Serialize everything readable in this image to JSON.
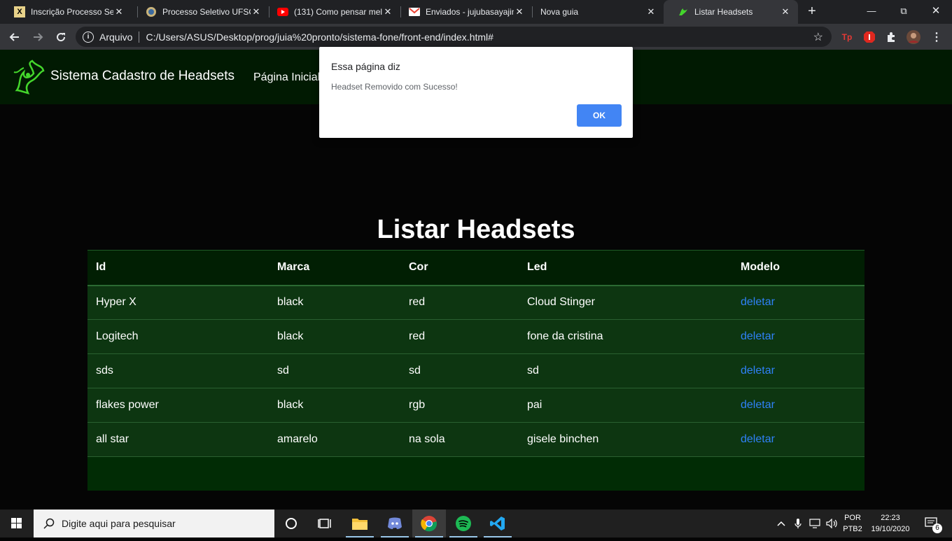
{
  "browser": {
    "tabs": [
      {
        "title": "Inscrição Processo Sele",
        "favicon": "X"
      },
      {
        "title": "Processo Seletivo UFSC",
        "favicon": "seal-icon"
      },
      {
        "title": "(131) Como pensar mel",
        "favicon": "youtube-icon"
      },
      {
        "title": "Enviados - jujubasayajin",
        "favicon": "gmail-icon"
      },
      {
        "title": "Nova guia",
        "favicon": ""
      },
      {
        "title": "Listar Headsets",
        "favicon": "razer-icon"
      }
    ],
    "close_glyph": "✕",
    "site_label": "Arquivo",
    "url": "C:/Users/ASUS/Desktop/prog/juia%20pronto/sistema-fone/front-end/index.html#",
    "ext_tp": "Tp"
  },
  "site": {
    "brand": "Sistema Cadastro de Headsets",
    "nav_home": "Página Inicial"
  },
  "main": {
    "heading": "Listar Headsets",
    "columns": [
      "Id",
      "Marca",
      "Cor",
      "Led",
      "Modelo"
    ],
    "rows": [
      [
        "Hyper X",
        "black",
        "red",
        "Cloud Stinger",
        "deletar"
      ],
      [
        "Logitech",
        "black",
        "red",
        "fone da cristina",
        "deletar"
      ],
      [
        "sds",
        "sd",
        "sd",
        "sd",
        "deletar"
      ],
      [
        "flakes power",
        "black",
        "rgb",
        "pai",
        "deletar"
      ],
      [
        "all star",
        "amarelo",
        "na sola",
        "gisele binchen",
        "deletar"
      ]
    ]
  },
  "dialog": {
    "title": "Essa página diz",
    "message": "Headset Removido com Sucesso!",
    "ok_label": "OK"
  },
  "taskbar": {
    "search_placeholder": "Digite aqui para pesquisar",
    "lang_top": "POR",
    "lang_bottom": "PTB2",
    "time": "22:23",
    "date": "19/10/2020",
    "notification_count": "6"
  },
  "colors": {
    "accent_green": "#44d62c",
    "link_blue": "#2f81f7",
    "dialog_button": "#4285f4"
  }
}
